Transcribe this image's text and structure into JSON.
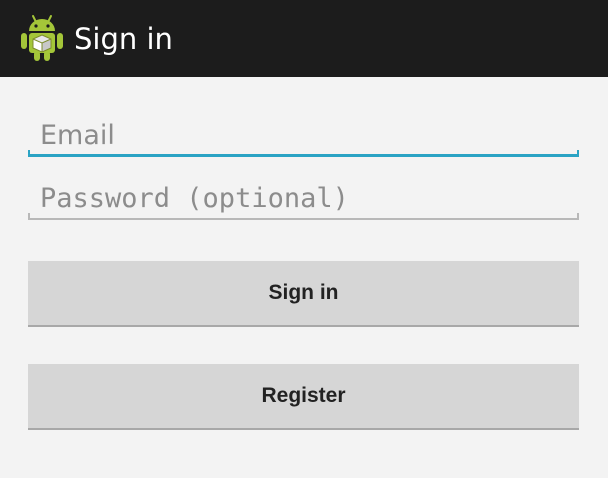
{
  "action_bar": {
    "title": "Sign in",
    "icon": "android-robot-icon",
    "background": "#1c1c1c"
  },
  "form": {
    "email": {
      "value": "",
      "placeholder": "Email",
      "focus_color": "#2aa3c4"
    },
    "password": {
      "value": "",
      "placeholder": "Password (optional)"
    },
    "sign_in_label": "Sign in",
    "register_label": "Register"
  },
  "colors": {
    "background": "#f3f3f3",
    "button": "#d6d6d6",
    "accent": "#2aa3c4",
    "android_green": "#a4c639"
  }
}
